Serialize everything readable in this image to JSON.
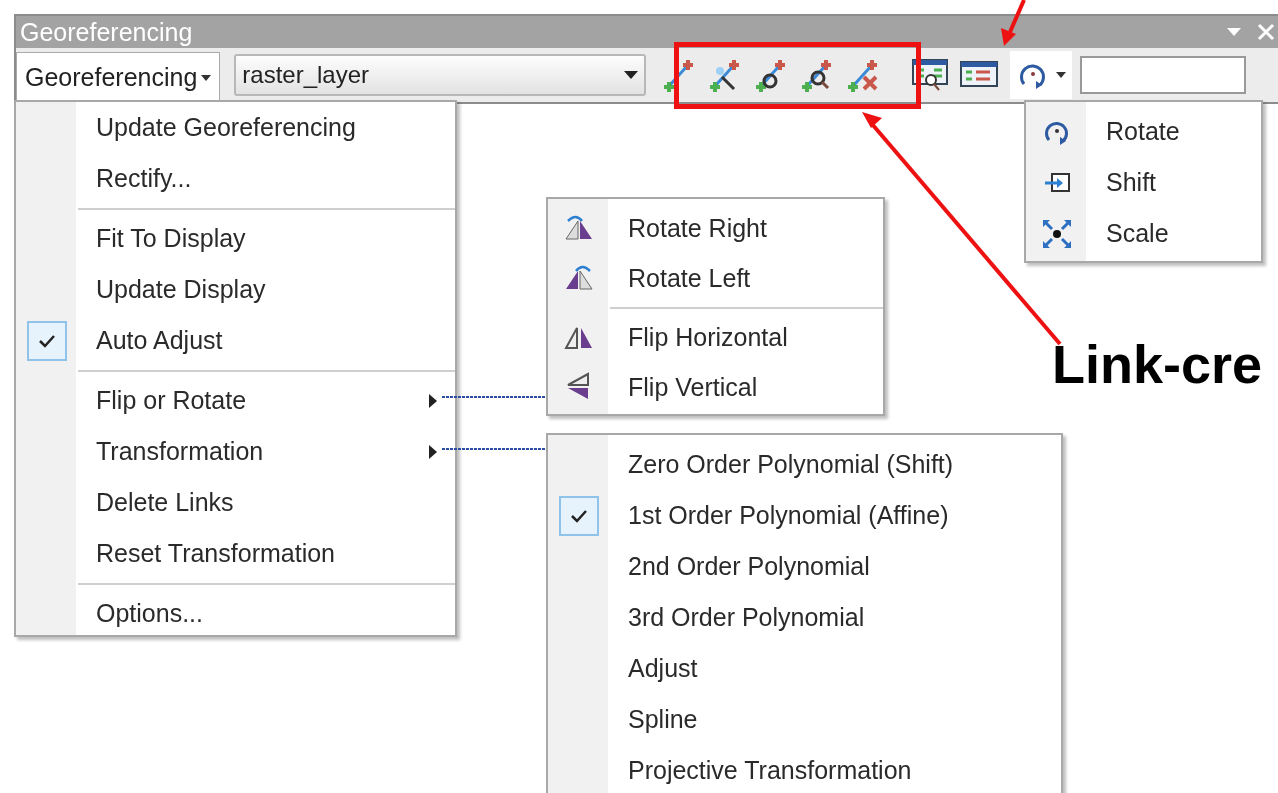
{
  "window": {
    "title": "Georeferencing"
  },
  "toolbar": {
    "menu_button": {
      "label": "Georeferencing",
      "selected": true
    },
    "layer_dropdown": {
      "value": "raster_layer"
    }
  },
  "georeferencing_menu": [
    {
      "kind": "item",
      "label": "Update Georeferencing",
      "checked": false,
      "submenu": false
    },
    {
      "kind": "item",
      "label": "Rectify...",
      "checked": false,
      "submenu": false
    },
    {
      "kind": "separator"
    },
    {
      "kind": "item",
      "label": "Fit To Display",
      "checked": false,
      "submenu": false
    },
    {
      "kind": "item",
      "label": "Update Display",
      "checked": false,
      "submenu": false
    },
    {
      "kind": "item",
      "label": "Auto Adjust",
      "checked": true,
      "submenu": false
    },
    {
      "kind": "separator"
    },
    {
      "kind": "item",
      "label": "Flip or Rotate",
      "checked": false,
      "submenu": true
    },
    {
      "kind": "item",
      "label": "Transformation",
      "checked": false,
      "submenu": true
    },
    {
      "kind": "item",
      "label": "Delete Links",
      "checked": false,
      "submenu": false
    },
    {
      "kind": "item",
      "label": "Reset Transformation",
      "checked": false,
      "submenu": false
    },
    {
      "kind": "separator"
    },
    {
      "kind": "item",
      "label": "Options...",
      "checked": false,
      "submenu": false
    }
  ],
  "flip_rotate_menu": [
    {
      "kind": "item",
      "label": "Rotate Right"
    },
    {
      "kind": "item",
      "label": "Rotate Left"
    },
    {
      "kind": "separator"
    },
    {
      "kind": "item",
      "label": "Flip Horizontal"
    },
    {
      "kind": "item",
      "label": "Flip Vertical"
    }
  ],
  "transformation_menu": [
    {
      "label": "Zero Order Polynomial (Shift)",
      "checked": false
    },
    {
      "label": "1st Order Polynomial (Affine)",
      "checked": true
    },
    {
      "label": "2nd Order Polynomial",
      "checked": false
    },
    {
      "label": "3rd Order Polynomial",
      "checked": false
    },
    {
      "label": "Adjust",
      "checked": false
    },
    {
      "label": "Spline",
      "checked": false
    },
    {
      "label": "Projective Transformation",
      "checked": false
    }
  ],
  "rotate_menu": [
    {
      "label": "Rotate"
    },
    {
      "label": "Shift"
    },
    {
      "label": "Scale"
    }
  ],
  "annotation": {
    "callout": "Link-cre"
  }
}
